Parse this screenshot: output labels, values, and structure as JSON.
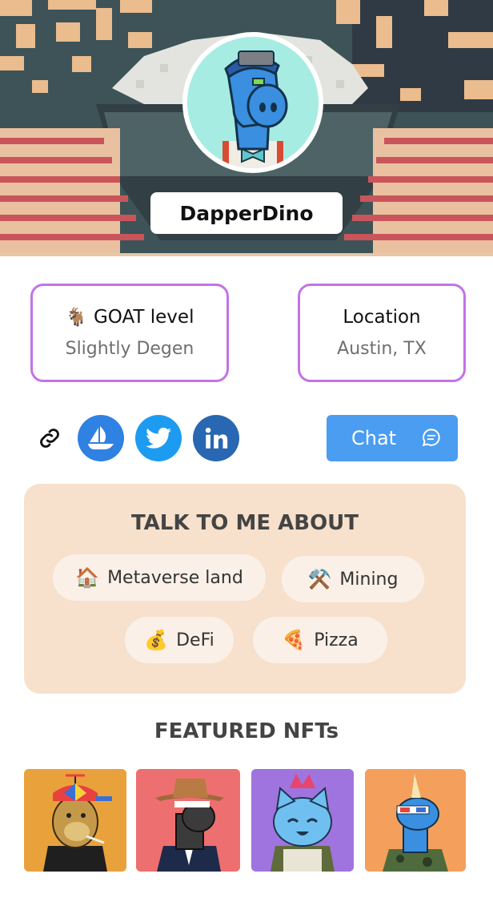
{
  "profile": {
    "username": "DapperDino"
  },
  "info_cards": {
    "goat": {
      "icon": "goat-emoji",
      "icon_glyph": "🐐",
      "label": "GOAT level",
      "value": "Slightly Degen"
    },
    "location": {
      "label": "Location",
      "value": "Austin, TX"
    }
  },
  "social": {
    "links": [
      {
        "name": "link-icon"
      },
      {
        "name": "opensea-icon"
      },
      {
        "name": "twitter-icon"
      },
      {
        "name": "linkedin-icon"
      }
    ],
    "chat_label": "Chat"
  },
  "talk": {
    "title": "TALK TO ME ABOUT",
    "topics": [
      {
        "emoji": "🏠",
        "label": "Metaverse land"
      },
      {
        "emoji": "⚒️",
        "label": "Mining"
      },
      {
        "emoji": "💰",
        "label": "DeFi"
      },
      {
        "emoji": "🍕",
        "label": "Pizza"
      }
    ]
  },
  "featured": {
    "title": "FEATURED NFTs",
    "items": [
      {
        "name": "nft-ape",
        "bg": "#e9a23b"
      },
      {
        "name": "nft-cowboy-dino",
        "bg": "#ee6f6f"
      },
      {
        "name": "nft-cat",
        "bg": "#a074de"
      },
      {
        "name": "nft-blue-dino",
        "bg": "#f4a05c"
      }
    ]
  },
  "colors": {
    "accent_border": "#c472e8",
    "chat_blue": "#4a9df0",
    "talk_bg": "#f7e1cc",
    "chip_bg": "#faf0e8"
  }
}
